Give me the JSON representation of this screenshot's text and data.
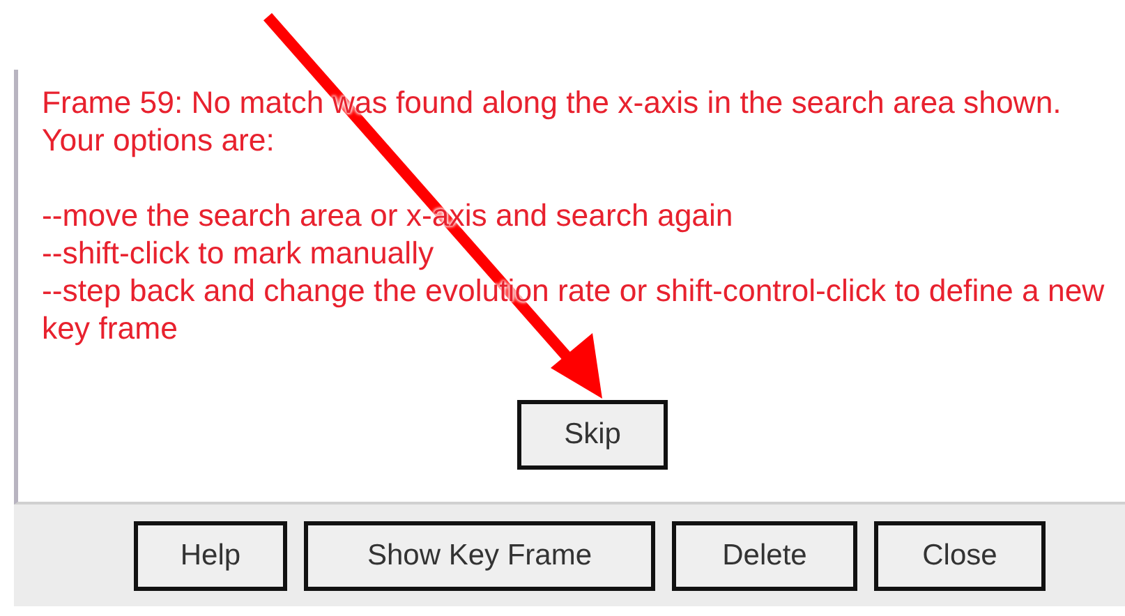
{
  "message": {
    "intro": "Frame 59: No match was found along the x-axis in the search area shown. Your options are:",
    "options": [
      "--move the search area or x-axis and search again",
      "--shift-click to mark manually",
      "--step back and change the evolution rate or shift-control-click to define a new key frame"
    ]
  },
  "skip_button": "Skip",
  "buttons": [
    "Help",
    "Show Key Frame",
    "Delete",
    "Close"
  ]
}
